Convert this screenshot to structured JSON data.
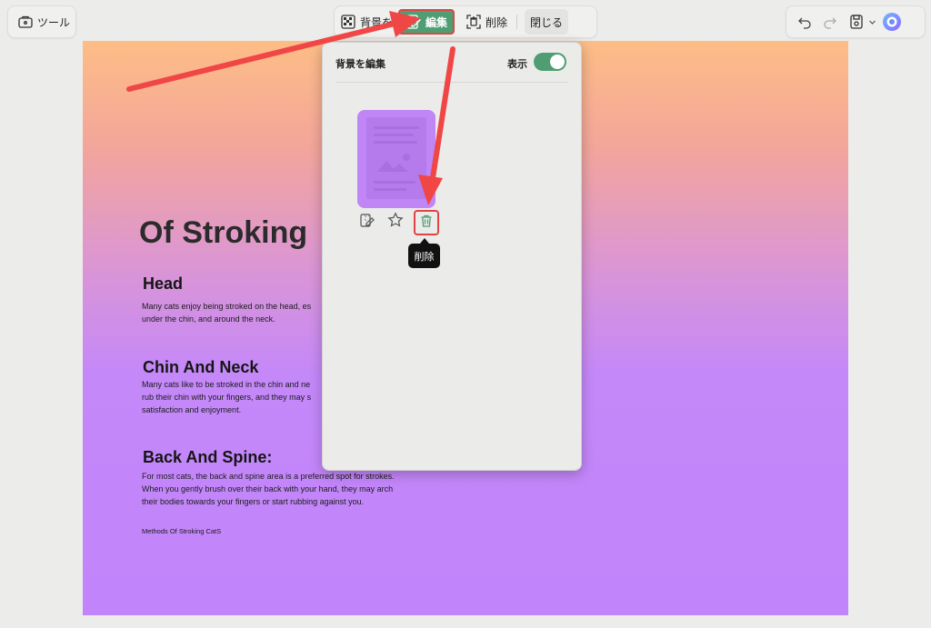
{
  "toolbar": {
    "tools_label": "ツール",
    "background_label": "背景を",
    "edit_label": "編集",
    "delete_label": "削除",
    "close_label": "閉じる"
  },
  "panel": {
    "title": "背景を編集",
    "show_label": "表示",
    "show_enabled": true,
    "delete_tooltip": "削除"
  },
  "document": {
    "title": "Of Stroking",
    "sections": [
      {
        "heading": "Head",
        "lines": [
          "Many cats enjoy being stroked on the head, es",
          "under the chin, and around the neck."
        ]
      },
      {
        "heading": "Chin And Neck",
        "lines": [
          "Many cats like to be stroked in the chin and ne",
          "rub their chin with your fingers, and they may s",
          "satisfaction and enjoyment."
        ]
      },
      {
        "heading": "Back And Spine:",
        "lines": [
          "For most cats, the back and spine area is a preferred spot for strokes.",
          "When you gently brush over their back with your hand, they may arch",
          "their bodies towards your fingers or start rubbing against you."
        ]
      }
    ],
    "footer": "Methods Of Stroking CatS"
  },
  "colors": {
    "accent_green": "#4f9e73",
    "highlight_red": "#e04444",
    "gradient_top": "#fdbd86",
    "gradient_bottom": "#c284fb"
  },
  "icons": [
    "toolbox-icon",
    "background-icon",
    "edit-background-icon",
    "delete-background-icon",
    "undo-icon",
    "redo-icon",
    "save-icon",
    "chevron-down-icon",
    "ai-assistant-icon",
    "edit-icon",
    "star-icon",
    "trash-icon"
  ]
}
